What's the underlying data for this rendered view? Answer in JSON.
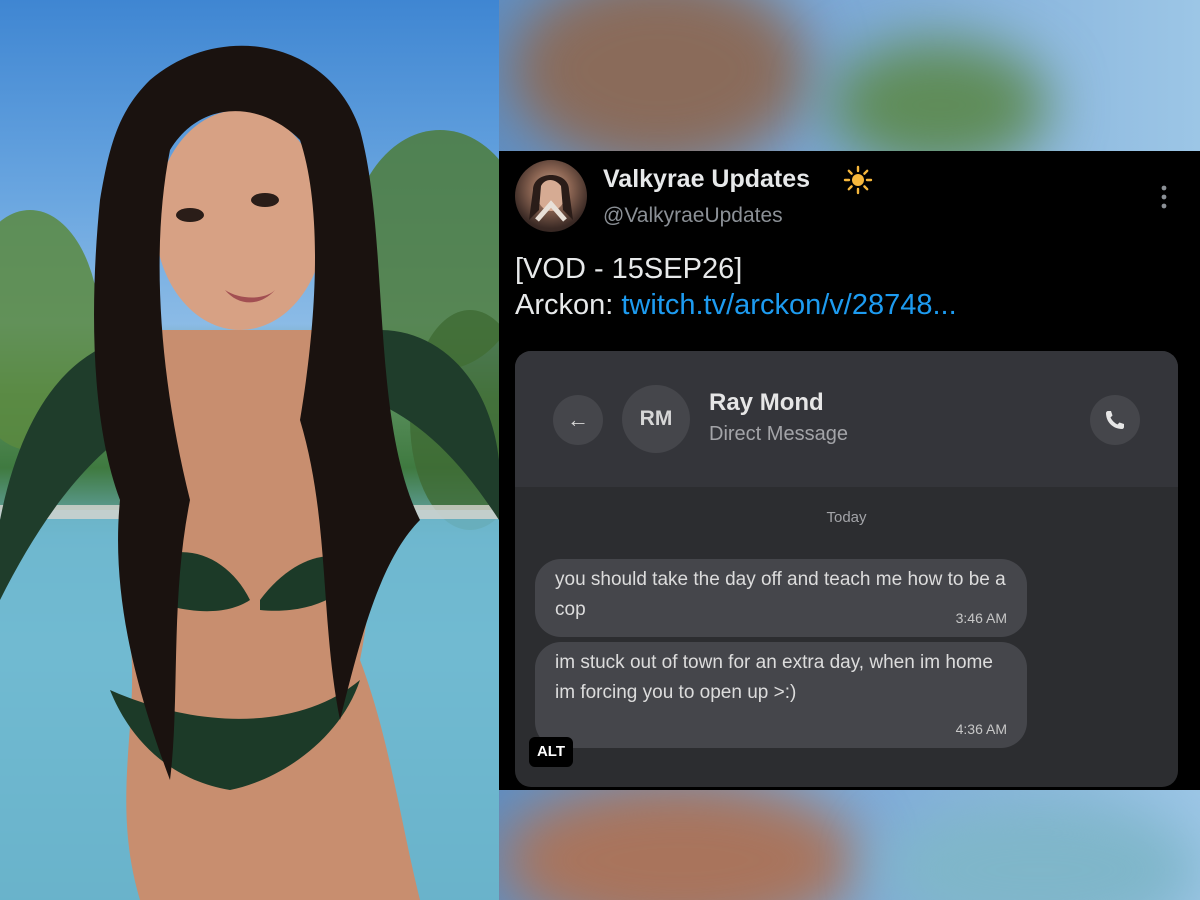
{
  "tweet": {
    "display_name": "Valkyrae Updates",
    "handle": "@ValkyraeUpdates",
    "emoji_icon": "sun-icon",
    "text_line1": "[VOD - 15SEP26]",
    "text_prefix": "Arckon: ",
    "link_text": "twitch.tv/arckon/v/28748..."
  },
  "screenshot": {
    "back_icon": "←",
    "contact_initials": "RM",
    "contact_name": "Ray Mond",
    "contact_subtitle": "Direct Message",
    "day_label": "Today",
    "messages": [
      {
        "text": "you should take the day off and teach me how to be a cop",
        "time": "3:46 AM"
      },
      {
        "text": "im stuck out of town for an extra day, when im home im forcing you to open up >:)",
        "time": "4:36 AM"
      }
    ]
  },
  "alt_badge": "ALT",
  "colors": {
    "background": "#000000",
    "text": "#e7e9ea",
    "secondary_text": "#8b9096",
    "link": "#1d9bf0",
    "dm_surface": "#2c2d30",
    "dm_bubble": "#45464b"
  }
}
